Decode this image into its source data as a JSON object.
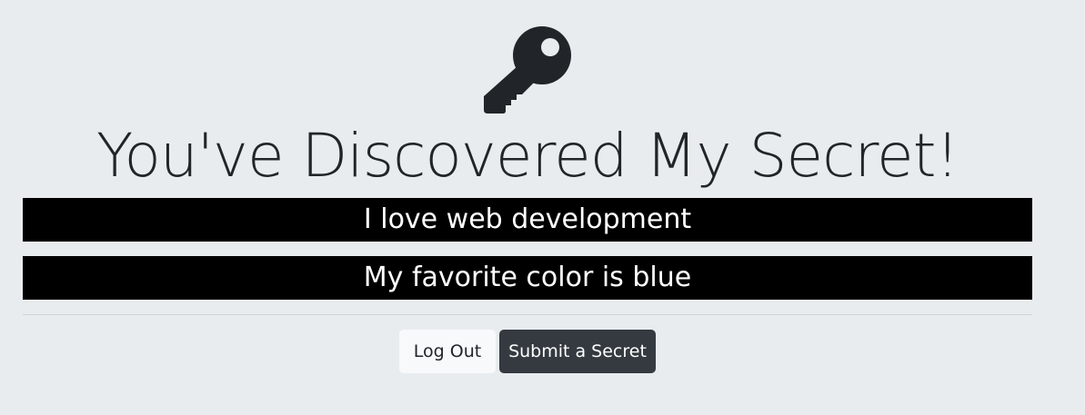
{
  "header": {
    "icon": "key-icon",
    "title": "You've Discovered My Secret!"
  },
  "secrets": [
    "I love web development",
    "My favorite color is blue"
  ],
  "actions": {
    "logout_label": "Log Out",
    "submit_label": "Submit a Secret"
  },
  "colors": {
    "background": "#e9ecef",
    "secret_bar": "#000000",
    "secret_text": "#ffffff",
    "dark_button": "#343a40",
    "light_button": "#f8f9fa",
    "text": "#212529"
  }
}
